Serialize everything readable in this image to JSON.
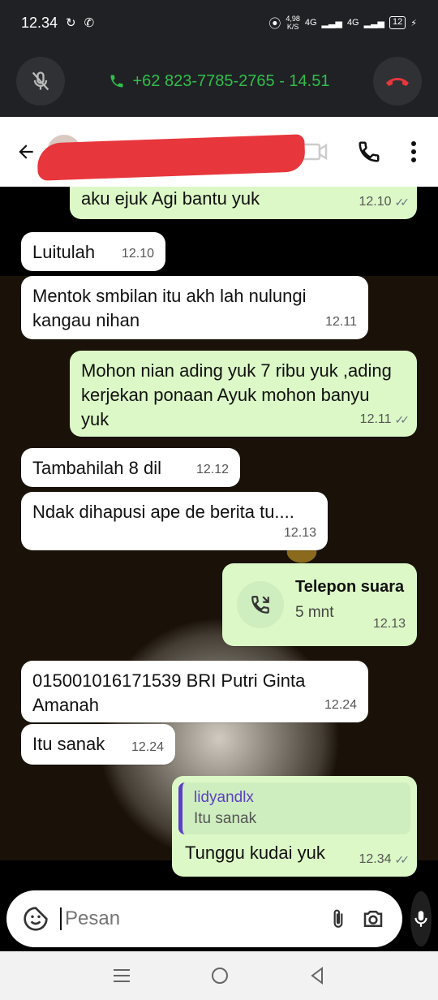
{
  "status_bar": {
    "time": "12.34",
    "net_speed_value": "4,98",
    "net_speed_unit": "K/S",
    "net_1": "4G",
    "net_2": "4G",
    "battery": "12"
  },
  "call_banner": {
    "info": "+62 823-7785-2765 - 14.51",
    "accent": "#2fbf4c"
  },
  "header": {
    "contact_name": "lidyandlx"
  },
  "messages": [
    {
      "type": "out",
      "text": "aku ejuk Agi bantu yuk",
      "time": "12.10",
      "read": true
    },
    {
      "type": "in",
      "text": "Luitulah",
      "time": "12.10"
    },
    {
      "type": "in",
      "text": "Mentok smbilan itu akh lah nulungi kangau nihan",
      "time": "12.11"
    },
    {
      "type": "out",
      "text": "Mohon nian ading yuk 7 ribu yuk ,ading kerjekan ponaan Ayuk mohon banyu yuk",
      "time": "12.11",
      "read": true
    },
    {
      "type": "in",
      "text": "Tambahilah 8 dil",
      "time": "12.12"
    },
    {
      "type": "in",
      "text": "Ndak dihapusi ape de berita tu....",
      "time": "12.13"
    },
    {
      "type": "call",
      "title": "Telepon suara",
      "duration": "5 mnt",
      "time": "12.13"
    },
    {
      "type": "in",
      "text": "015001016171539 BRI Putri Ginta Amanah",
      "time": "12.24"
    },
    {
      "type": "in",
      "text": "Itu sanak",
      "time": "12.24"
    },
    {
      "type": "reply",
      "quote_author": "lidyandlx",
      "quote_text": "Itu sanak",
      "text": "Tunggu kudai yuk",
      "time": "12.34",
      "read": true
    }
  ],
  "input": {
    "placeholder": "Pesan"
  },
  "colors": {
    "outgoing_bubble": "#dcf8c6",
    "incoming_bubble": "#ffffff",
    "quote_accent": "#5b3fc4",
    "end_call": "#e8363d"
  }
}
